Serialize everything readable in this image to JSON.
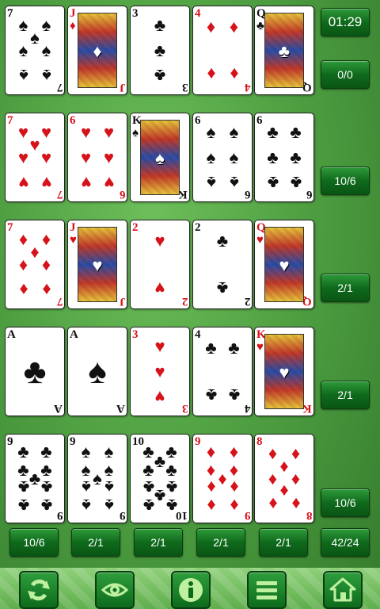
{
  "timer": "01:29",
  "counters": {
    "top": "0/0",
    "rows": [
      "10/6",
      "2/1",
      "2/1",
      "10/6"
    ],
    "columns": [
      "10/6",
      "2/1",
      "2/1",
      "2/1",
      "2/1"
    ],
    "total": "42/24"
  },
  "cards": [
    [
      {
        "rank": "7",
        "suit": "♠",
        "color": "black"
      },
      {
        "rank": "J",
        "suit": "♦",
        "color": "red"
      },
      {
        "rank": "3",
        "suit": "♣",
        "color": "black"
      },
      {
        "rank": "4",
        "suit": "♦",
        "color": "red"
      },
      {
        "rank": "Q",
        "suit": "♣",
        "color": "black"
      }
    ],
    [
      {
        "rank": "7",
        "suit": "♥",
        "color": "red"
      },
      {
        "rank": "6",
        "suit": "♥",
        "color": "red"
      },
      {
        "rank": "K",
        "suit": "♠",
        "color": "black"
      },
      {
        "rank": "6",
        "suit": "♠",
        "color": "black"
      },
      {
        "rank": "6",
        "suit": "♣",
        "color": "black"
      }
    ],
    [
      {
        "rank": "7",
        "suit": "♦",
        "color": "red"
      },
      {
        "rank": "J",
        "suit": "♥",
        "color": "red"
      },
      {
        "rank": "2",
        "suit": "♥",
        "color": "red"
      },
      {
        "rank": "2",
        "suit": "♣",
        "color": "black"
      },
      {
        "rank": "Q",
        "suit": "♥",
        "color": "red"
      }
    ],
    [
      {
        "rank": "A",
        "suit": "♣",
        "color": "black"
      },
      {
        "rank": "A",
        "suit": "♠",
        "color": "black"
      },
      {
        "rank": "3",
        "suit": "♥",
        "color": "red"
      },
      {
        "rank": "4",
        "suit": "♣",
        "color": "black"
      },
      {
        "rank": "K",
        "suit": "♥",
        "color": "red"
      }
    ],
    [
      {
        "rank": "9",
        "suit": "♣",
        "color": "black"
      },
      {
        "rank": "9",
        "suit": "♠",
        "color": "black"
      },
      {
        "rank": "10",
        "suit": "♣",
        "color": "black"
      },
      {
        "rank": "9",
        "suit": "♦",
        "color": "red"
      },
      {
        "rank": "8",
        "suit": "♦",
        "color": "red"
      }
    ]
  ],
  "toolbar": [
    {
      "icon": "refresh-icon"
    },
    {
      "icon": "eye-icon"
    },
    {
      "icon": "info-icon"
    },
    {
      "icon": "menu-icon"
    },
    {
      "icon": "home-icon"
    }
  ]
}
